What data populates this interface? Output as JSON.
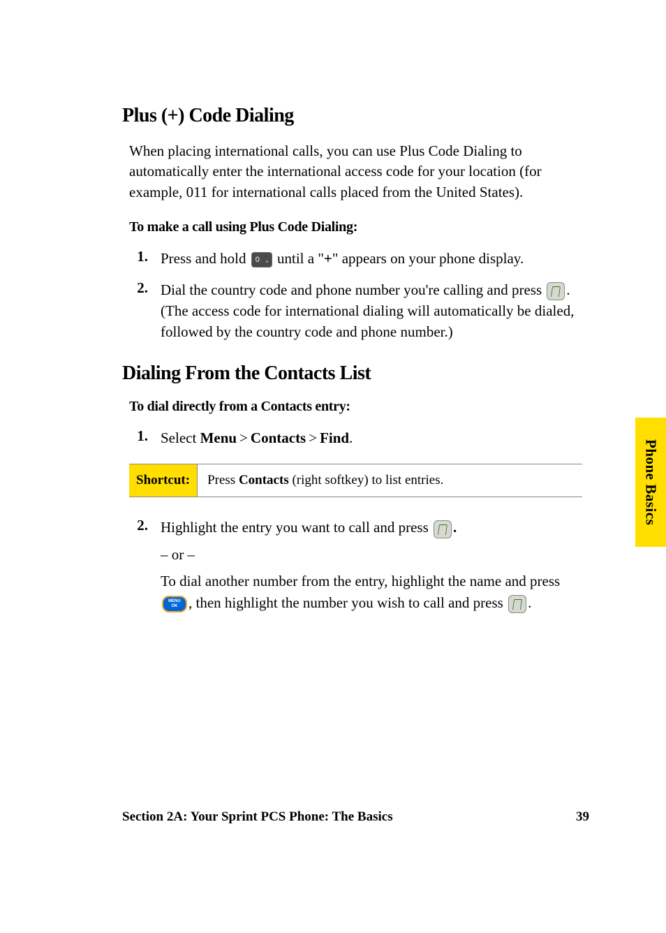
{
  "section1": {
    "heading": "Plus (+) Code Dialing",
    "intro": "When placing international calls, you can use Plus Code Dialing to automatically enter the international access code for your location (for example, 011 for international calls placed from the United States).",
    "subhead": "To make a call using Plus Code Dialing:",
    "step1_num": "1.",
    "step1_a": "Press and hold ",
    "step1_b": " until a \"",
    "step1_plus": "+",
    "step1_c": "\" appears on your phone display.",
    "step2_num": "2.",
    "step2_a": "Dial the country code and phone number you're calling and press ",
    "step2_b": ". (The access code for international dialing will automatically be dialed, followed by the country code and phone number.)"
  },
  "section2": {
    "heading": "Dialing From the Contacts List",
    "subhead": "To dial directly from a Contacts entry:",
    "step1_num": "1.",
    "step1_a": "Select ",
    "step1_menu": "Menu",
    "step1_sep": ">",
    "step1_contacts": "Contacts",
    "step1_find": "Find",
    "step1_end": ".",
    "shortcut_label": "Shortcut:",
    "shortcut_a": "Press ",
    "shortcut_b": "Contacts",
    "shortcut_c": " (right softkey) to list entries.",
    "step2_num": "2.",
    "step2_a": "Highlight the entry you want to call and press ",
    "step2_dot": ".",
    "step2_or": "– or –",
    "step2_b": "To dial another number from the entry, highlight the name and press ",
    "step2_c": ", then highlight the number you wish to call and press ",
    "step2_d": "."
  },
  "sidetab": "Phone Basics",
  "footer_left": "Section 2A: Your Sprint PCS Phone: The Basics",
  "footer_right": "39"
}
